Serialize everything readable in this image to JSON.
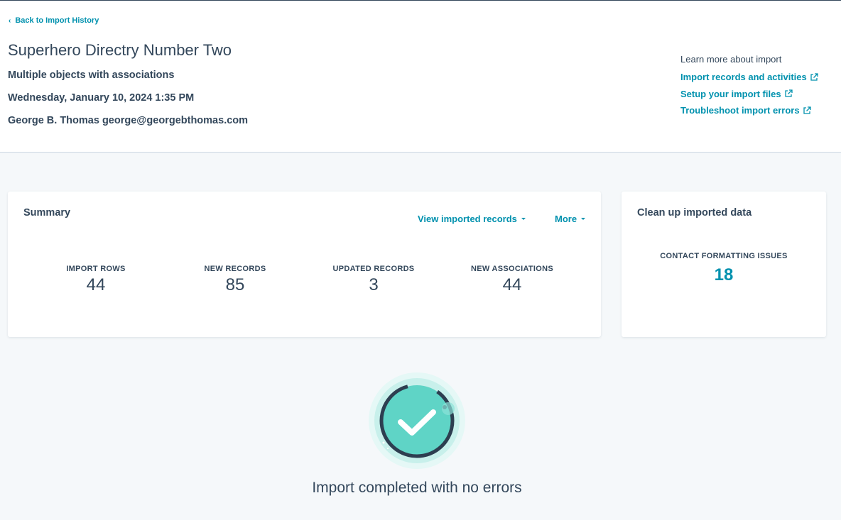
{
  "header": {
    "back_link": "Back to Import History",
    "title": "Superhero Directry Number Two",
    "subtitle": "Multiple objects with associations",
    "date": "Wednesday, January 10, 2024 1:35 PM",
    "user": "George B. Thomas george@georgebthomas.com"
  },
  "learn_more": {
    "heading": "Learn more about import",
    "links": [
      {
        "label": "Import records and activities",
        "icon": "external-link-icon"
      },
      {
        "label": "Setup your import files",
        "icon": "external-link-icon"
      },
      {
        "label": "Troubleshoot import errors",
        "icon": "external-link-icon"
      }
    ]
  },
  "summary": {
    "title": "Summary",
    "view_records_label": "View imported records",
    "more_label": "More",
    "stats": [
      {
        "label": "IMPORT ROWS",
        "value": "44"
      },
      {
        "label": "NEW RECORDS",
        "value": "85"
      },
      {
        "label": "UPDATED RECORDS",
        "value": "3"
      },
      {
        "label": "NEW ASSOCIATIONS",
        "value": "44"
      }
    ]
  },
  "cleanup": {
    "title": "Clean up imported data",
    "issue_label": "CONTACT FORMATTING ISSUES",
    "issue_value": "18"
  },
  "status": {
    "message": "Import completed with no errors",
    "icon": "success-check-icon"
  },
  "colors": {
    "text": "#33475b",
    "link": "#0091ae",
    "background": "#f5f8fa",
    "success_teal": "#5fd4c6",
    "success_ring": "#2d3e50"
  }
}
